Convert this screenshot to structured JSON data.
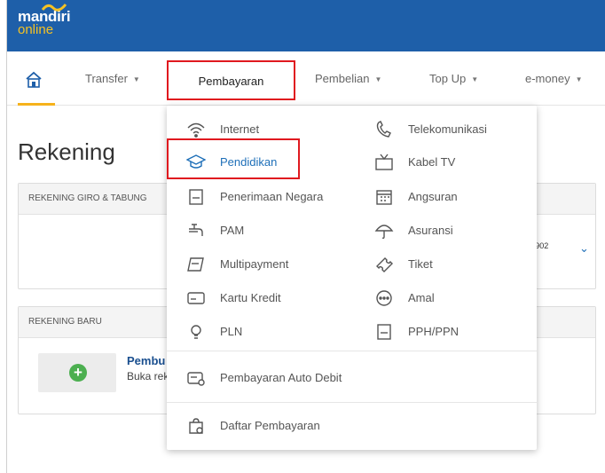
{
  "app": {
    "brand": "mandiri",
    "brand_sub": "online"
  },
  "nav": {
    "items": [
      "Transfer",
      "Pembayaran",
      "Pembelian",
      "Top Up",
      "e-money"
    ]
  },
  "page": {
    "title": "Rekening"
  },
  "cards": {
    "giro_header": "REKENING GIRO & TABUNG",
    "giro_value_suffix": "902",
    "baru_header": "REKENING BARU",
    "baru_title": "Pembu",
    "baru_sub": "Buka rek"
  },
  "dropdown": {
    "left": [
      "Internet",
      "Pendidikan",
      "Penerimaan Negara",
      "PAM",
      "Multipayment",
      "Kartu Kredit",
      "PLN"
    ],
    "right": [
      "Telekomunikasi",
      "Kabel TV",
      "Angsuran",
      "Asuransi",
      "Tiket",
      "Amal",
      "PPH/PPN"
    ],
    "auto_debit": "Pembayaran Auto Debit",
    "daftar": "Daftar Pembayaran"
  },
  "colors": {
    "header": "#1e5fa9",
    "accent": "#f6b21b",
    "highlight": "#e0191f",
    "active_link": "#1e6fb8"
  }
}
